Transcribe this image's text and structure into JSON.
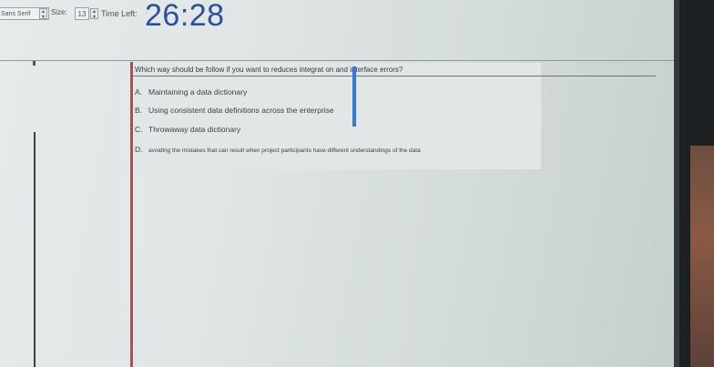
{
  "toolbar": {
    "font_name": "Sans Serif",
    "size_label": "Size:",
    "size_value": "13",
    "time_left_label": "Time Left:",
    "timer": "26:28"
  },
  "question": {
    "text": "Which way should be follow if you want to reduces integrat on and interface errors?",
    "options": [
      {
        "letter": "A.",
        "text": "Maintaining a data dictionary"
      },
      {
        "letter": "B.",
        "text": "Using consistent data definitions across the enterprise"
      },
      {
        "letter": "C.",
        "text": "Throwaway data dictionary"
      },
      {
        "letter": "D.",
        "text": "avoiding the mistakes that can result when project participants have different understandings of the data"
      }
    ]
  }
}
